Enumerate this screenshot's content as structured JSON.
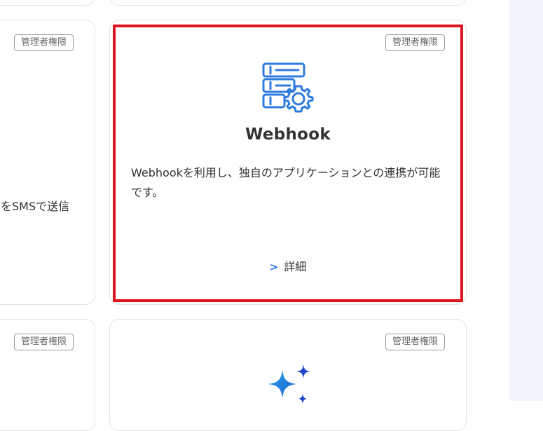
{
  "cards": {
    "top_left": {
      "badge": "管理者権限",
      "desc_fragment": "をSMSで送信"
    },
    "webhook": {
      "badge": "管理者権限",
      "icon": "server-gear-icon",
      "title": "Webhook",
      "description": "Webhookを利用し、独自のアプリケーションとの連携が可能です。",
      "detail_label": "詳細",
      "accent_color": "#2f7be0"
    },
    "bottom_left": {
      "badge": "管理者権限"
    },
    "bottom_right": {
      "badge": "管理者権限",
      "icon": "sparkle-icon"
    }
  },
  "highlight_color": "#e0141e"
}
